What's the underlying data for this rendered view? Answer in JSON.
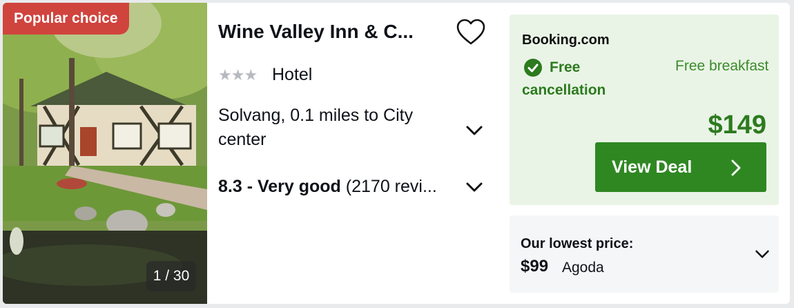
{
  "photo": {
    "badge": "Popular choice",
    "counter": "1 / 30"
  },
  "hotel": {
    "name": "Wine Valley Inn & C...",
    "stars": 3,
    "type": "Hotel",
    "location": "Solvang, 0.1 miles to City center",
    "rating_score": "8.3 - Very good",
    "rating_reviews": "(2170 revi..."
  },
  "deal": {
    "provider": "Booking.com",
    "free_cancellation": "Free cancellation",
    "free_breakfast": "Free breakfast",
    "price": "$149",
    "button_label": "View Deal"
  },
  "lowest": {
    "label": "Our lowest price:",
    "price": "$99",
    "provider": "Agoda"
  },
  "colors": {
    "badge": "#d0443e",
    "accent_green": "#2f8722",
    "deal_bg": "#e9f4e6"
  },
  "icons": [
    "heart-icon",
    "star-icon",
    "chevron-down-icon",
    "check-circle-icon",
    "chevron-right-icon"
  ]
}
